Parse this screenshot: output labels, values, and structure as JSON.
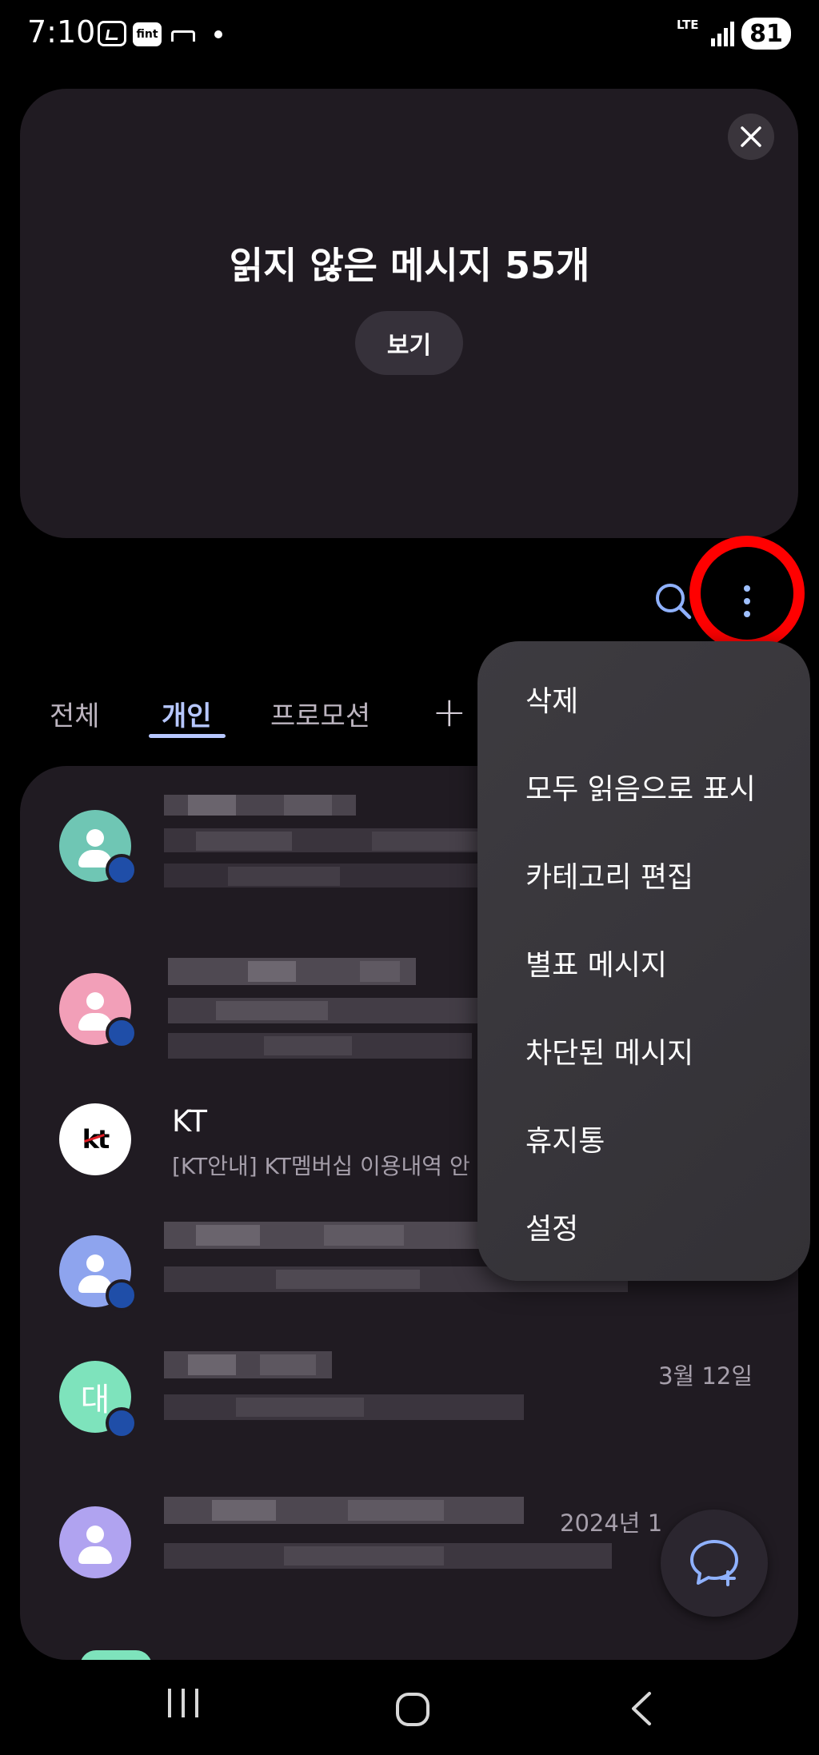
{
  "status_bar": {
    "time": "7:10",
    "fint_label": "fint",
    "network": "LTE",
    "battery": "81"
  },
  "banner": {
    "title": "읽지 않은 메시지 55개",
    "view_button": "보기"
  },
  "tabs": [
    {
      "label": "전체",
      "active": false
    },
    {
      "label": "개인",
      "active": true
    },
    {
      "label": "프로모션",
      "active": false
    }
  ],
  "conversations": [
    {
      "title": "",
      "preview": "",
      "date": "",
      "avatar_color": "#6fc6b4",
      "badge": true
    },
    {
      "title": "",
      "preview": "",
      "date": "",
      "avatar_color": "#f29fb8",
      "badge": true
    },
    {
      "title": "KT",
      "preview": "[KT안내] KT멤버십 이용내역 안",
      "date": "",
      "avatar_color": "#ffffff",
      "avatar_text": "kt",
      "badge": false
    },
    {
      "title": "",
      "preview": "",
      "date": "",
      "avatar_color": "#8ea4ee",
      "badge": true
    },
    {
      "title": "",
      "preview": "",
      "date": "3월 12일",
      "avatar_color": "#7ee3bc",
      "avatar_text": "대",
      "badge": true
    },
    {
      "title": "",
      "preview": "",
      "date": "2024년 1",
      "avatar_color": "#b0a3f0",
      "badge": false
    }
  ],
  "menu": {
    "items": [
      "삭제",
      "모두 읽음으로 표시",
      "카테고리 편집",
      "별표 메시지",
      "차단된 메시지",
      "휴지통",
      "설정"
    ]
  },
  "colors": {
    "accent": "#b7c7ff",
    "highlight": "#ff0000",
    "panel": "#201b22"
  }
}
